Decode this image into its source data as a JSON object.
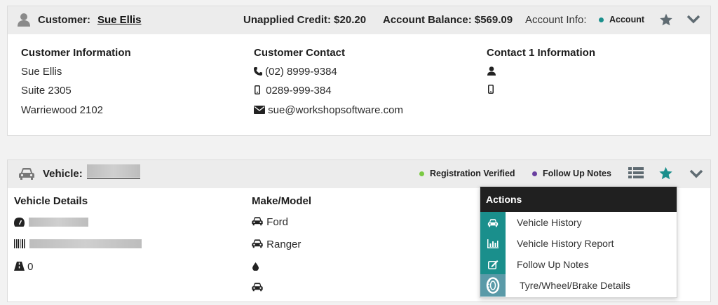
{
  "customer": {
    "label": "Customer:",
    "name": "Sue Ellis",
    "unapplied_credit": "Unapplied Credit: $20.20",
    "account_balance": "Account Balance: $569.09",
    "account_info_label": "Account Info:",
    "account_tag": "Account",
    "columns": {
      "info_title": "Customer Information",
      "info_name": "Sue Ellis",
      "info_addr1": "Suite 2305",
      "info_addr2": "Warriewood 2102",
      "contact_title": "Customer Contact",
      "phone": "(02) 8999-9384",
      "mobile": "0289-999-384",
      "email": "sue@workshopsoftware.com",
      "contact1_title": "Contact 1 Information"
    }
  },
  "vehicle": {
    "label": "Vehicle:",
    "registration_tag": "Registration Verified",
    "followup_tag": "Follow Up Notes",
    "details_title": "Vehicle Details",
    "odometer": "0",
    "makemodel_title": "Make/Model",
    "make": "Ford",
    "model": "Ranger"
  },
  "actions_menu": {
    "title": "Actions",
    "items": [
      {
        "label": "Vehicle History",
        "icon": "car-icon"
      },
      {
        "label": "Vehicle History Report",
        "icon": "bar-chart-icon"
      },
      {
        "label": "Follow Up Notes",
        "icon": "edit-icon"
      },
      {
        "label": "Tyre/Wheel/Brake Details",
        "icon": "tyre-icon"
      }
    ]
  },
  "colors": {
    "teal": "#1a8f8c",
    "green": "#7ac943",
    "purple": "#6a3fa0",
    "icon_gray": "#5f6b72"
  }
}
